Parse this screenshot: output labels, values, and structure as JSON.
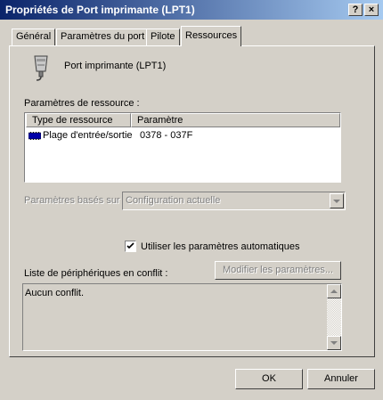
{
  "window": {
    "title": "Propriétés de Port imprimante (LPT1)",
    "help_btn": "?",
    "close_btn": "×"
  },
  "tabs": [
    {
      "label": "Général",
      "active": false
    },
    {
      "label": "Paramètres du port",
      "active": false
    },
    {
      "label": "Pilote",
      "active": false
    },
    {
      "label": "Ressources",
      "active": true
    }
  ],
  "device": {
    "name": "Port imprimante (LPT1)",
    "icon": "parallel-port-icon"
  },
  "resources": {
    "label": "Paramètres de ressource :",
    "headers": [
      "Type de ressource",
      "Paramètre"
    ],
    "rows": [
      {
        "type": "Plage d'entrée/sortie",
        "value": "0378 - 037F",
        "icon": "io-range-icon"
      }
    ]
  },
  "based_on": {
    "label": "Paramètres basés sur :",
    "value": "Configuration actuelle",
    "enabled": false
  },
  "auto_settings": {
    "label": "Utiliser les paramètres automatiques",
    "checked": true
  },
  "conflicts": {
    "label": "Liste de périphériques en conflit :",
    "modify_button": "Modifier les paramètres...",
    "text": "Aucun conflit."
  },
  "footer": {
    "ok": "OK",
    "cancel": "Annuler"
  }
}
